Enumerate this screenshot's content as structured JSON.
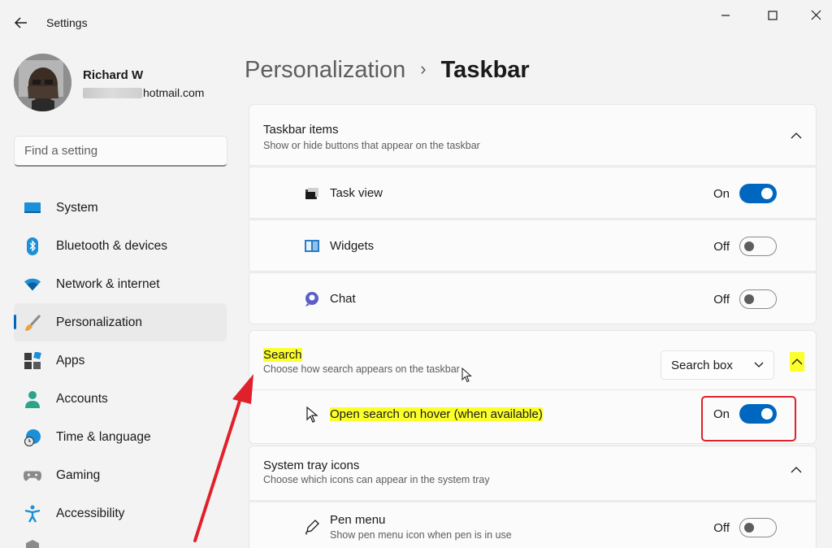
{
  "window": {
    "title": "Settings"
  },
  "profile": {
    "name": "Richard W",
    "email_domain": "hotmail.com"
  },
  "search": {
    "placeholder": "Find a setting"
  },
  "nav": {
    "items": [
      {
        "label": "System",
        "icon": "system-icon"
      },
      {
        "label": "Bluetooth & devices",
        "icon": "bluetooth-icon"
      },
      {
        "label": "Network & internet",
        "icon": "wifi-icon"
      },
      {
        "label": "Personalization",
        "icon": "brush-icon",
        "active": true
      },
      {
        "label": "Apps",
        "icon": "apps-icon"
      },
      {
        "label": "Accounts",
        "icon": "person-icon"
      },
      {
        "label": "Time & language",
        "icon": "globe-clock-icon"
      },
      {
        "label": "Gaming",
        "icon": "gamepad-icon"
      },
      {
        "label": "Accessibility",
        "icon": "accessibility-icon"
      }
    ]
  },
  "breadcrumb": {
    "parent": "Personalization",
    "separator": "›",
    "current": "Taskbar"
  },
  "taskbar_items": {
    "title": "Taskbar items",
    "subtitle": "Show or hide buttons that appear on the taskbar",
    "rows": [
      {
        "label": "Task view",
        "state": "On",
        "on": true,
        "icon": "task-view-icon"
      },
      {
        "label": "Widgets",
        "state": "Off",
        "on": false,
        "icon": "widgets-icon"
      },
      {
        "label": "Chat",
        "state": "Off",
        "on": false,
        "icon": "chat-icon"
      }
    ]
  },
  "search_section": {
    "title": "Search",
    "subtitle": "Choose how search appears on the taskbar",
    "dropdown_value": "Search box",
    "row": {
      "label": "Open search on hover (when available)",
      "state": "On",
      "on": true,
      "icon": "pointer-icon"
    }
  },
  "system_tray": {
    "title": "System tray icons",
    "subtitle": "Choose which icons can appear in the system tray",
    "rows": [
      {
        "label": "Pen menu",
        "sublabel": "Show pen menu icon when pen is in use",
        "state": "Off",
        "on": false,
        "icon": "pen-icon"
      }
    ]
  },
  "colors": {
    "accent": "#0067c0",
    "highlight": "#fbff2a",
    "annotation_red": "#e0202b"
  }
}
